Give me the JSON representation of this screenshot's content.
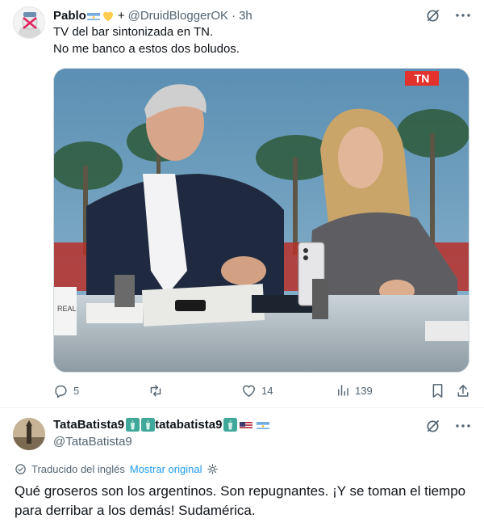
{
  "tweet": {
    "author_name": "Pablo",
    "author_suffix": "+",
    "handle": "@DruidBloggerOK",
    "separator": "·",
    "time": "3h",
    "text_line1": "TV del bar sintonizada en TN.",
    "text_line2": "No me banco a estos dos boludos.",
    "media": {
      "channel_logo": "TN",
      "ticker_text": "REAL"
    },
    "stats": {
      "replies": "5",
      "reposts": "",
      "likes": "14",
      "views": "139"
    }
  },
  "reply": {
    "author_name_part1": "TataBatista9",
    "author_name_part2": "tatabatista9",
    "handle": "@TataBatista9",
    "translated_label": "Traducido del inglés",
    "show_original": "Mostrar original",
    "text": "Qué groseros son los argentinos. Son repugnantes. ¡Y se toman el tiempo para derribar a los demás! Sudamérica."
  },
  "icons": {
    "grok": "grok-slash-icon",
    "more": "more-dots-icon",
    "reply": "reply-icon",
    "repost": "repost-icon",
    "like": "heart-icon",
    "views": "views-bars-icon",
    "bookmark": "bookmark-icon",
    "share": "share-icon",
    "settings": "gear-icon"
  },
  "colors": {
    "text": "#0f1419",
    "muted": "#536471",
    "link": "#1d9bf0",
    "border": "#eff3f4"
  }
}
